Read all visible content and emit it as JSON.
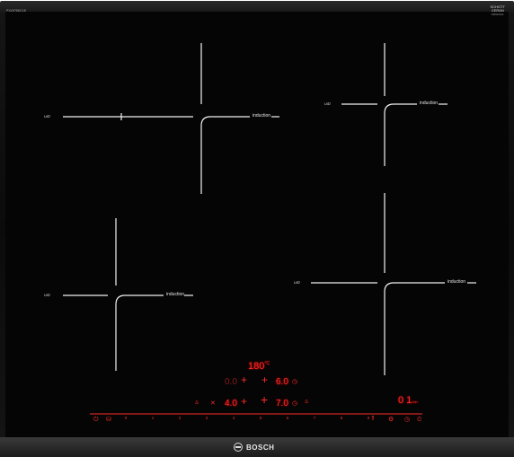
{
  "cooktop": {
    "model": "PXV975DC1E",
    "schott_brand": "SCHOTT\nCERAN",
    "schott_sub": "ORIGINAL",
    "zones": [
      {
        "id": "front-left-top",
        "label": "induction",
        "flex": "UlU̅"
      },
      {
        "id": "rear-right",
        "label": "induction",
        "flex": "UlU̅"
      },
      {
        "id": "front-left-bottom",
        "label": "induction",
        "flex": "UlU̅"
      },
      {
        "id": "front-right",
        "label": "induction",
        "flex": "UlU̅"
      }
    ]
  },
  "control_panel": {
    "temperature": "180",
    "temperature_unit": "°C",
    "rear_left_level": "0.0",
    "rear_right_level": "6.0",
    "front_left_level": "4.0",
    "front_right_level": "7.0",
    "timer": "0 1",
    "timer_unit": "min",
    "scale": [
      "0",
      "1",
      "2",
      "3",
      "4",
      "5",
      "6",
      "7",
      "8",
      "9"
    ]
  },
  "brand": {
    "name": "BOSCH"
  },
  "colors": {
    "display_red": "#ff2a2a",
    "glass": "#050505",
    "frame": "#1b1b1b"
  }
}
